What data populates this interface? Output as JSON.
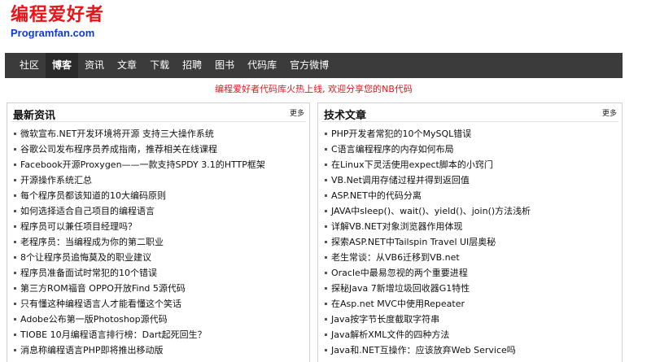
{
  "logo": {
    "cn": "编程爱好者",
    "en": "Programfan.com"
  },
  "nav": [
    "社区",
    "博客",
    "资讯",
    "文章",
    "下载",
    "招聘",
    "图书",
    "代码库",
    "官方微博"
  ],
  "notice": "编程爱好者代码库火热上线, 欢迎分享您的NB代码",
  "left_panel": {
    "title": "最新资讯",
    "more": "更多",
    "items": [
      "微软宣布.NET开发环境将开源 支持三大操作系统",
      "谷歌公司发布程序员养成指南，推荐相关在线课程",
      "Facebook开源Proxygen——一款支持SPDY 3.1的HTTP框架",
      "开源操作系统汇总",
      "每个程序员都该知道的10大编码原则",
      "如何选择适合自己项目的编程语言",
      "程序员可以兼任项目经理吗？",
      "老程序员：当编程成为你的第二职业",
      "8个让程序员追悔莫及的职业建议",
      "程序员准备面试时常犯的10个错误",
      "第三方ROM福音 OPPO开放Find 5源代码",
      "只有懂这种编程语言人才能看懂这个笑话",
      "Adobe公布第一版Photoshop源代码",
      "TIOBE 10月编程语言排行榜：Dart起死回生？",
      "消息称编程语言PHP即将推出移动版"
    ]
  },
  "right_panel": {
    "title": "技术文章",
    "more": "更多",
    "items": [
      "PHP开发者常犯的10个MySQL错误",
      "C语言编程程序的内存如何布局",
      "在Linux下灵活使用expect脚本的小窍门",
      "VB.Net调用存储过程并得到返回值",
      "ASP.NET中的代码分离",
      "JAVA中sleep()、wait()、yield()、join()方法浅析",
      "详解VB.NET对象浏览器作用体现",
      "探索ASP.NET中Tailspin Travel UI层奥秘",
      "老生常谈：从VB6迁移到VB.net",
      "Oracle中最易忽视的两个重要进程",
      "探秘Java 7新增垃圾回收器G1特性",
      "在Asp.net MVC中使用Repeater",
      "Java按字节长度截取字符串",
      "Java解析XML文件的四种方法",
      "Java和.NET互操作：应该放弃Web Service吗"
    ]
  }
}
